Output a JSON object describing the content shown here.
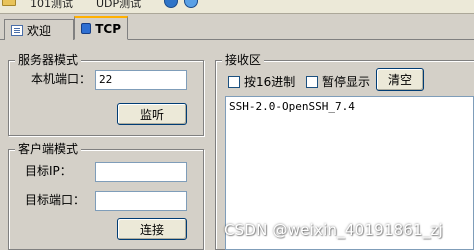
{
  "toolbar": {
    "item1": "101测试",
    "item2": "UDP测试"
  },
  "tabs": [
    {
      "label": "欢迎",
      "active": false,
      "icon": "document-icon"
    },
    {
      "label": "TCP",
      "active": true,
      "icon": "tcp-icon"
    }
  ],
  "server": {
    "title": "服务器模式",
    "port_label": "本机端口：",
    "port_value": "22",
    "listen_button": "监听"
  },
  "client": {
    "title": "客户端模式",
    "target_ip_label": "目标IP：",
    "target_ip_value": "",
    "target_port_label": "目标端口：",
    "target_port_value": "",
    "connect_button": "连接"
  },
  "receive": {
    "title": "接收区",
    "hex_label": "按16进制",
    "pause_label": "暂停显示",
    "clear_button": "清空",
    "content": "SSH-2.0-OpenSSH_7.4"
  },
  "watermark": "CSDN @weixin_40191861_zj"
}
